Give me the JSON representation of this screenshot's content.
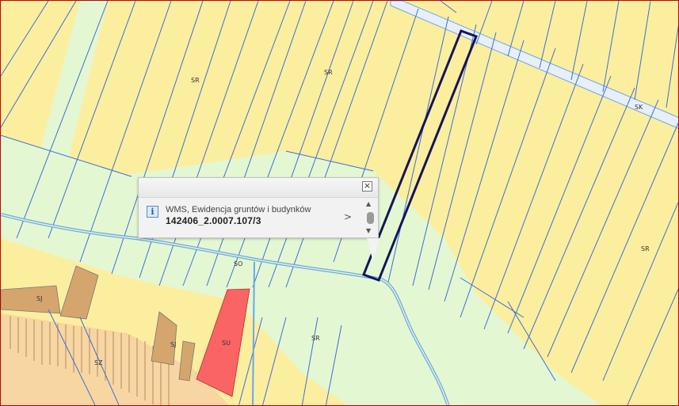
{
  "map": {
    "zone_labels": [
      {
        "text": "SR"
      },
      {
        "text": "SR"
      },
      {
        "text": "SK"
      },
      {
        "text": "SR"
      },
      {
        "text": "SO"
      },
      {
        "text": "SJ"
      },
      {
        "text": "SJ"
      },
      {
        "text": "SU"
      },
      {
        "text": "SR"
      },
      {
        "text": "SZ"
      }
    ],
    "colors": {
      "arable": "#fcee9f",
      "meadow": "#e4f7d3",
      "built_residential": "#d4a66e",
      "built_light": "#f8d6a2",
      "built_highlight": "#fa6464",
      "road": "#e7eff8",
      "parcel_line": "#3c6fd4",
      "water": "#6aa7e8",
      "selected_outline": "#14145a",
      "frame": "#c00000"
    }
  },
  "popup": {
    "layer_name": "WMS, Ewidencja gruntów i budynków",
    "parcel_id": "142406_2.0007.107/3",
    "info_icon": "info-icon",
    "close_icon": "close-icon",
    "next_icon": "chevron-right-icon",
    "close_symbol": "×",
    "next_symbol": ">",
    "scroll_up_symbol": "▲",
    "scroll_down_symbol": "▼"
  }
}
